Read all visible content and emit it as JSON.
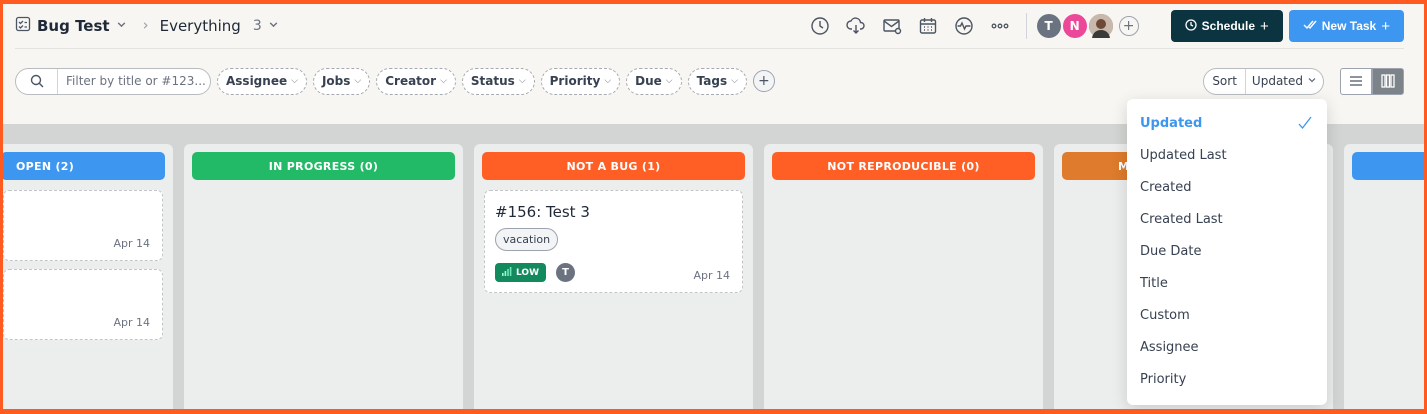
{
  "header": {
    "board_title": "Bug Test",
    "view_name": "Everything",
    "view_count": "3",
    "toolbar_icons": [
      "clock-icon",
      "cloud-download-icon",
      "mail-icon",
      "calendar-icon",
      "activity-icon",
      "more-icon"
    ],
    "avatars": [
      {
        "initial": "T",
        "color": "#6b7280"
      },
      {
        "initial": "N",
        "color": "#ec4899"
      },
      {
        "initial": "",
        "color": "#8a6a58"
      }
    ],
    "schedule_label": "Schedule",
    "new_task_label": "New Task"
  },
  "filters": {
    "search_placeholder": "Filter by title or #123...",
    "chips": [
      "Assignee",
      "Jobs",
      "Creator",
      "Status",
      "Priority",
      "Due",
      "Tags"
    ],
    "sort_label": "Sort",
    "sort_value": "Updated"
  },
  "columns": [
    {
      "title": "OPEN (2)",
      "color": "#3d97f0"
    },
    {
      "title": "IN PROGRESS (0)",
      "color": "#22b967"
    },
    {
      "title": "NOT A BUG (1)",
      "color": "#ff5f25"
    },
    {
      "title": "NOT REPRODUCIBLE (0)",
      "color": "#ff5f25"
    },
    {
      "title": "M",
      "color": "#de7b2c"
    },
    {
      "title": "",
      "color": "#3d97f0"
    }
  ],
  "cards": {
    "open": [
      {
        "date": "Apr 14"
      },
      {
        "date": "Apr 14"
      }
    ],
    "not_a_bug": [
      {
        "title": "#156: Test 3",
        "tag": "vacation",
        "priority": "LOW",
        "assignee": "T",
        "date": "Apr 14"
      }
    ]
  },
  "sort_menu": {
    "selected": "Updated",
    "items": [
      "Updated",
      "Updated Last",
      "Created",
      "Created Last",
      "Due Date",
      "Title",
      "Custom",
      "Assignee",
      "Priority"
    ]
  }
}
